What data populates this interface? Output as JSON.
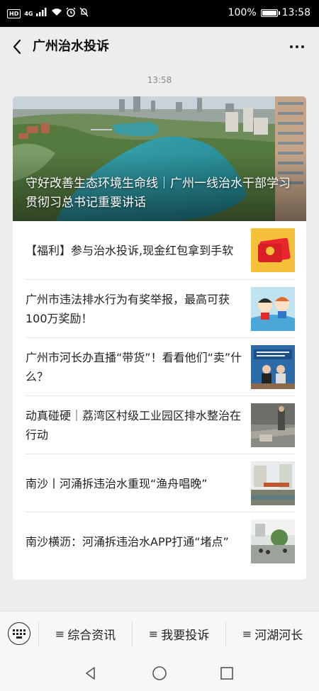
{
  "status_bar": {
    "hd_label": "HD",
    "network_label": "4G",
    "battery_percent": "100%",
    "battery_level": 1.0,
    "time": "13:58"
  },
  "header": {
    "title": "广州治水投诉"
  },
  "chat": {
    "timestamp": "13:58"
  },
  "card": {
    "hero_title": "守好改善生态环境生命线｜广州一线治水干部学习贯彻习总书记重要讲话",
    "articles": [
      {
        "title": "【福利】参与治水投诉,现金红包拿到手软",
        "thumb_icon": "red-envelope-icon"
      },
      {
        "title": "广州市违法排水行为有奖举报，最高可获100万奖励！",
        "thumb_icon": "cartoon-illustration-icon"
      },
      {
        "title": "广州市河长办直播“带货”！看看他们“卖”什么？",
        "thumb_icon": "livestream-photo-icon"
      },
      {
        "title": "动真碰硬｜荔湾区村级工业园区排水整治在行动",
        "thumb_icon": "construction-photo-icon"
      },
      {
        "title": "南沙丨河涌拆违治水重现“渔舟唱晚”",
        "thumb_icon": "riverside-photo-icon"
      },
      {
        "title": "南沙横沥：河涌拆违治水APP打通“堵点”",
        "thumb_icon": "street-photo-icon"
      }
    ]
  },
  "bottom_menu": {
    "items": [
      {
        "label": "综合资讯"
      },
      {
        "label": "我要投诉"
      },
      {
        "label": "河湖河长"
      }
    ],
    "hamburger_glyph": "≡"
  },
  "colors": {
    "page_bg": "#ededed",
    "card_bg": "#ffffff",
    "status_bar_bg": "#000000",
    "text_primary": "#222222",
    "text_secondary": "#8a8a8a",
    "red_envelope": "#e8262b"
  }
}
